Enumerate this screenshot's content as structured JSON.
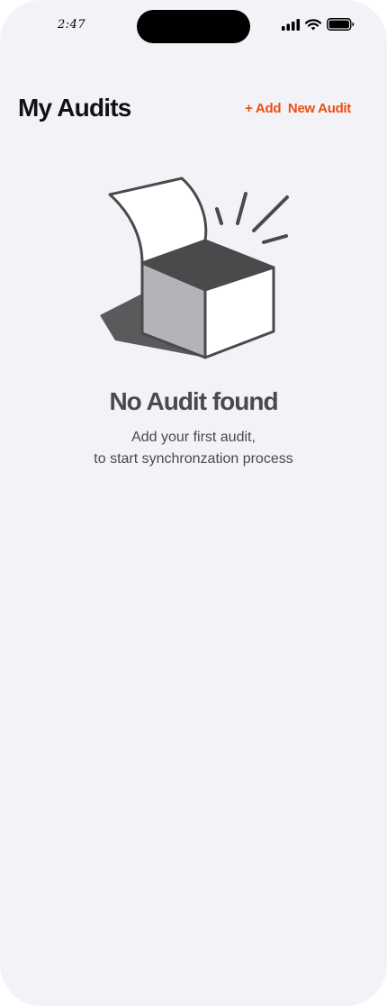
{
  "status_bar": {
    "time": "2:47",
    "icons": [
      "signal-icon",
      "wifi-icon",
      "battery-icon"
    ]
  },
  "header": {
    "title": "My Audits",
    "add_label": "+ Add  New Audit"
  },
  "empty_state": {
    "illustration": "open-box-icon",
    "title": "No Audit found",
    "subtitle_line1": "Add your first audit,",
    "subtitle_line2": "to start synchronzation process"
  },
  "colors": {
    "accent": "#f04e12",
    "background": "#f2f2f7",
    "text_dark": "#111111",
    "text_muted": "#4a4a4c"
  }
}
